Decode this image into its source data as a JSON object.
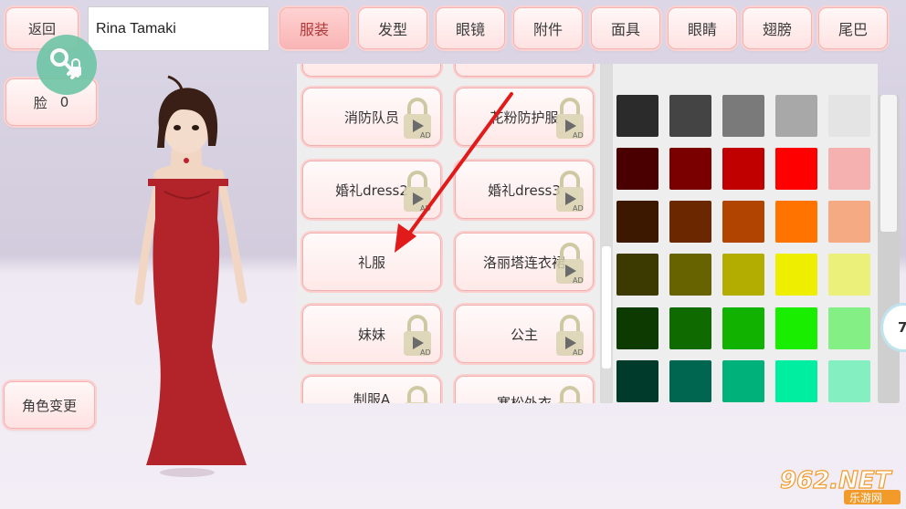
{
  "top_bar": {
    "back_label": "返回",
    "character_name": "Rina Tamaki"
  },
  "tabs": [
    {
      "label": "服装",
      "active": true
    },
    {
      "label": "发型",
      "active": false
    },
    {
      "label": "眼镜",
      "active": false
    },
    {
      "label": "附件",
      "active": false
    },
    {
      "label": "面具",
      "active": false
    },
    {
      "label": "眼睛",
      "active": false
    },
    {
      "label": "翅膀",
      "active": false
    },
    {
      "label": "尾巴",
      "active": false
    }
  ],
  "left_panel": {
    "face_label": "脸",
    "face_value": "0",
    "change_character_label": "角色变更"
  },
  "items": [
    {
      "label": "消防队员",
      "locked": true
    },
    {
      "label": "花粉防护服",
      "locked": true
    },
    {
      "label": "婚礼dress2",
      "locked": true
    },
    {
      "label": "婚礼dress3",
      "locked": true
    },
    {
      "label": "礼服",
      "locked": false
    },
    {
      "label": "洛丽塔连衣裙",
      "locked": true
    },
    {
      "label": "妹妹",
      "locked": true
    },
    {
      "label": "公主",
      "locked": true
    },
    {
      "label": "制服A",
      "locked": true
    },
    {
      "label": "寒松外衣",
      "locked": true
    }
  ],
  "lock_badge_text": "AD",
  "palette": {
    "rows": [
      [
        "#2b2b2b",
        "#444444",
        "#7a7a7a",
        "#a8a8a8",
        "#e4e4e4"
      ],
      [
        "#4a0000",
        "#7a0000",
        "#c00000",
        "#ff0000",
        "#f5b0b0"
      ],
      [
        "#3d1800",
        "#6a2700",
        "#b04400",
        "#ff7400",
        "#f5aa84"
      ],
      [
        "#3c3a00",
        "#666300",
        "#b2ad00",
        "#eeee00",
        "#eaf07a"
      ],
      [
        "#0c3a00",
        "#0f6a00",
        "#12b200",
        "#19ee00",
        "#84ef84"
      ],
      [
        "#003a2a",
        "#006650",
        "#00b27a",
        "#00eea0",
        "#84efc0"
      ]
    ]
  },
  "zoom_value": "7",
  "watermark": {
    "brand": "962.NET",
    "subtitle": "乐游网"
  },
  "colors": {
    "accent": "#f3b3b3",
    "active_tab": "#f9b5b5",
    "dress": "#b3232a"
  }
}
